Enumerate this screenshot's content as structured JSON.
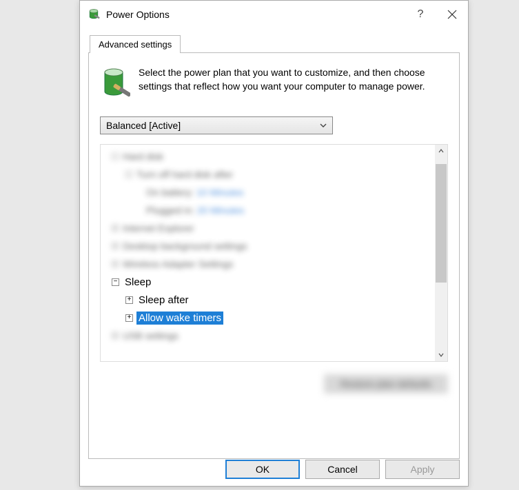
{
  "window": {
    "title": "Power Options",
    "help_symbol": "?",
    "close_label": "Close"
  },
  "tab": {
    "label": "Advanced settings"
  },
  "header": {
    "description": "Select the power plan that you want to customize, and then choose settings that reflect how you want your computer to manage power."
  },
  "plan_selector": {
    "selected": "Balanced [Active]"
  },
  "tree": {
    "blurred_rows": [
      {
        "indent": 0,
        "text": "Hard disk",
        "box": "-"
      },
      {
        "indent": 1,
        "text": "Turn off hard disk after",
        "box": "-"
      },
      {
        "indent": 2,
        "label": "On battery:",
        "value": "10 Minutes"
      },
      {
        "indent": 2,
        "label": "Plugged in:",
        "value": "20 Minutes"
      },
      {
        "indent": 0,
        "text": "Internet Explorer",
        "box": "+"
      },
      {
        "indent": 0,
        "text": "Desktop background settings",
        "box": "+"
      },
      {
        "indent": 0,
        "text": "Wireless Adapter Settings",
        "box": "+"
      }
    ],
    "sleep": {
      "label": "Sleep",
      "children": [
        {
          "label": "Sleep after",
          "expander": "+"
        },
        {
          "label": "Allow wake timers",
          "expander": "+",
          "selected": true
        }
      ]
    },
    "blurred_bottom": {
      "indent": 0,
      "text": "USB settings",
      "box": "+"
    }
  },
  "restore_defaults_label": "Restore plan defaults",
  "buttons": {
    "ok": "OK",
    "cancel": "Cancel",
    "apply": "Apply"
  }
}
